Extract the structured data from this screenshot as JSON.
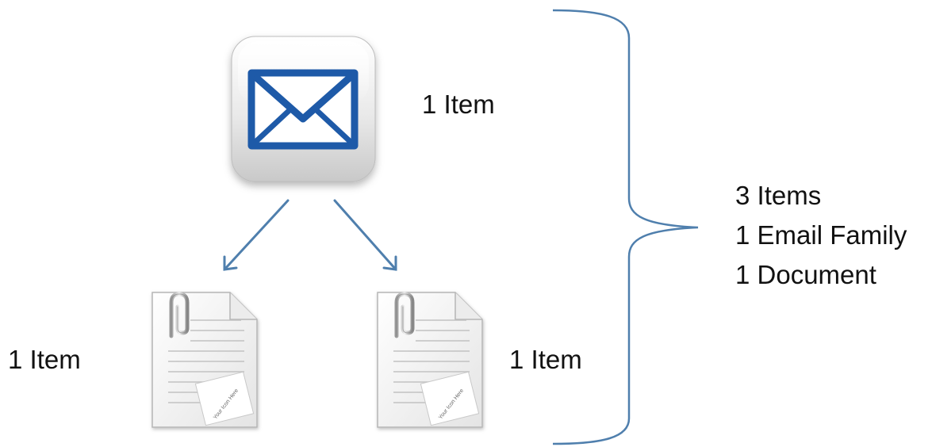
{
  "nodes": {
    "email": {
      "icon": "email-envelope-icon",
      "count_label": "1 Item"
    },
    "left_attachment": {
      "icon": "attached-document-icon",
      "count_label": "1 Item",
      "page_stamp": "Your Icon Here"
    },
    "right_attachment": {
      "icon": "attached-document-icon",
      "count_label": "1 Item",
      "page_stamp": "Your Icon Here"
    }
  },
  "summary": {
    "lines": [
      "3 Items",
      "1 Email Family",
      "1 Document"
    ]
  },
  "colors": {
    "arrow": "#4f7fad",
    "brace": "#4f7fad",
    "envelope": "#1e5aa8",
    "text": "#111111"
  }
}
